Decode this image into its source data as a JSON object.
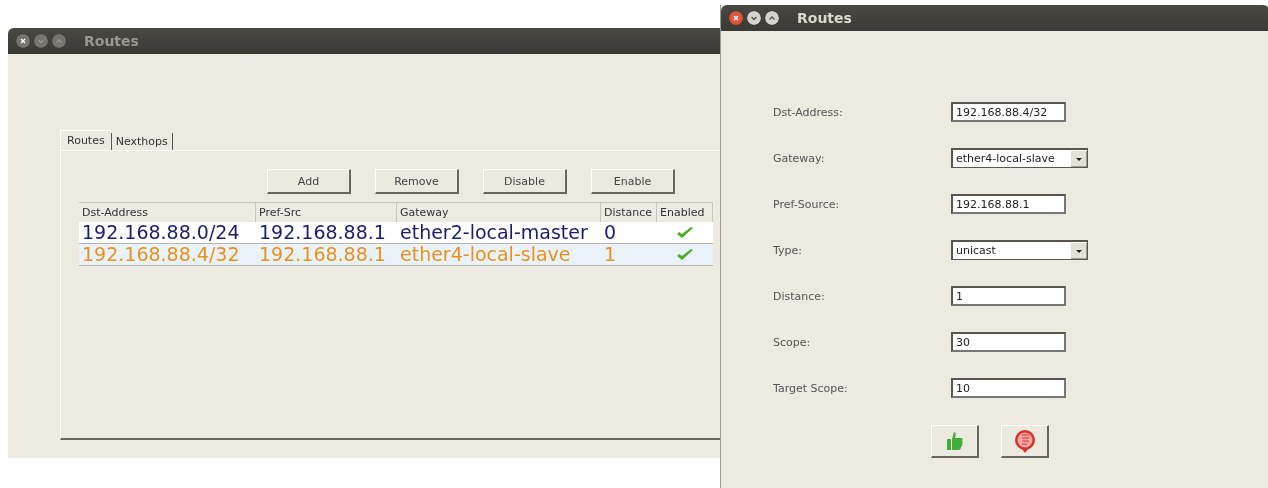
{
  "main_window": {
    "title": "Routes",
    "active": false,
    "tabs": [
      {
        "label": "Routes",
        "selected": true
      },
      {
        "label": "Nexthops",
        "selected": false
      }
    ],
    "buttons": [
      "Add",
      "Remove",
      "Disable",
      "Enable"
    ],
    "table": {
      "columns": [
        "Dst-Address",
        "Pref-Src",
        "Gateway",
        "Distance",
        "Enabled"
      ],
      "rows": [
        {
          "cells": [
            "192.168.88.0/24",
            "192.168.88.1",
            "ether2-local-master",
            "0"
          ],
          "enabled": true,
          "selected": false,
          "color": "#1c1c72"
        },
        {
          "cells": [
            "192.168.88.4/32",
            "192.168.88.1",
            "ether4-local-slave",
            "1"
          ],
          "enabled": true,
          "selected": true,
          "color": "#e8911f"
        }
      ]
    }
  },
  "dialog": {
    "title": "Routes",
    "active": true,
    "fields": [
      {
        "label": "Dst-Address:",
        "value": "192.168.88.4/32",
        "kind": "text"
      },
      {
        "label": "Gateway:",
        "value": "ether4-local-slave",
        "kind": "dropdown"
      },
      {
        "label": "Pref-Source:",
        "value": "192.168.88.1",
        "kind": "text"
      },
      {
        "label": "Type:",
        "value": "unicast",
        "kind": "dropdown"
      },
      {
        "label": "Distance:",
        "value": "1",
        "kind": "text"
      },
      {
        "label": "Scope:",
        "value": "30",
        "kind": "text"
      },
      {
        "label": "Target Scope:",
        "value": "10",
        "kind": "text"
      }
    ],
    "buttons": [
      {
        "kind": "ok"
      },
      {
        "kind": "cancel"
      }
    ]
  }
}
